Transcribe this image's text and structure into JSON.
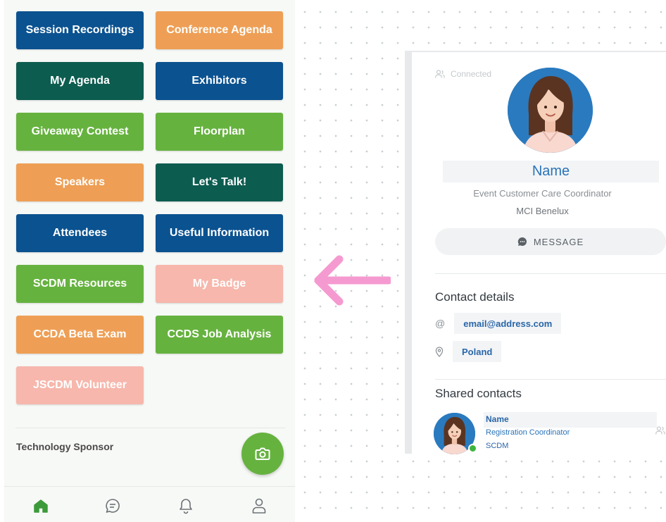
{
  "menu_tiles": [
    {
      "label": "Session Recordings",
      "color": "#0b5290"
    },
    {
      "label": "Conference Agenda",
      "color": "#ee9f55"
    },
    {
      "label": "My Agenda",
      "color": "#0d5c50"
    },
    {
      "label": "Exhibitors",
      "color": "#0b5290"
    },
    {
      "label": "Giveaway Contest",
      "color": "#66b23f"
    },
    {
      "label": "Floorplan",
      "color": "#66b23f"
    },
    {
      "label": "Speakers",
      "color": "#ee9f55"
    },
    {
      "label": "Let's Talk!",
      "color": "#0d5c50"
    },
    {
      "label": "Attendees",
      "color": "#0b5290"
    },
    {
      "label": "Useful Information",
      "color": "#0b5290"
    },
    {
      "label": "SCDM Resources",
      "color": "#66b23f"
    },
    {
      "label": "My Badge",
      "color": "#f7b7ac"
    },
    {
      "label": "CCDA Beta Exam",
      "color": "#ee9f55"
    },
    {
      "label": "CCDS Job Analysis",
      "color": "#66b23f"
    },
    {
      "label": "JSCDM Volunteer",
      "color": "#f7b7ac"
    }
  ],
  "sponsor": {
    "label": "Technology Sponsor"
  },
  "fab": {
    "icon": "camera-icon"
  },
  "bottom_nav": [
    {
      "icon": "home-icon",
      "active": true
    },
    {
      "icon": "chat-icon",
      "active": false
    },
    {
      "icon": "bell-icon",
      "active": false
    },
    {
      "icon": "user-icon",
      "active": false
    }
  ],
  "profile": {
    "status": "Connected",
    "name": "Name",
    "job_title": "Event Customer Care Coordinator",
    "company": "MCI Benelux",
    "message_button": "MESSAGE"
  },
  "contact_details": {
    "title": "Contact details",
    "email": "email@address.com",
    "location": "Poland"
  },
  "shared_contacts": {
    "title": "Shared contacts",
    "items": [
      {
        "name": "Name",
        "title": "Registration Coordinator",
        "company": "SCDM"
      }
    ]
  },
  "colors": {
    "accent_green": "#66b23f",
    "navy": "#0b5290",
    "arrow_pink": "#f59ad0",
    "link_blue": "#2a73b8"
  }
}
